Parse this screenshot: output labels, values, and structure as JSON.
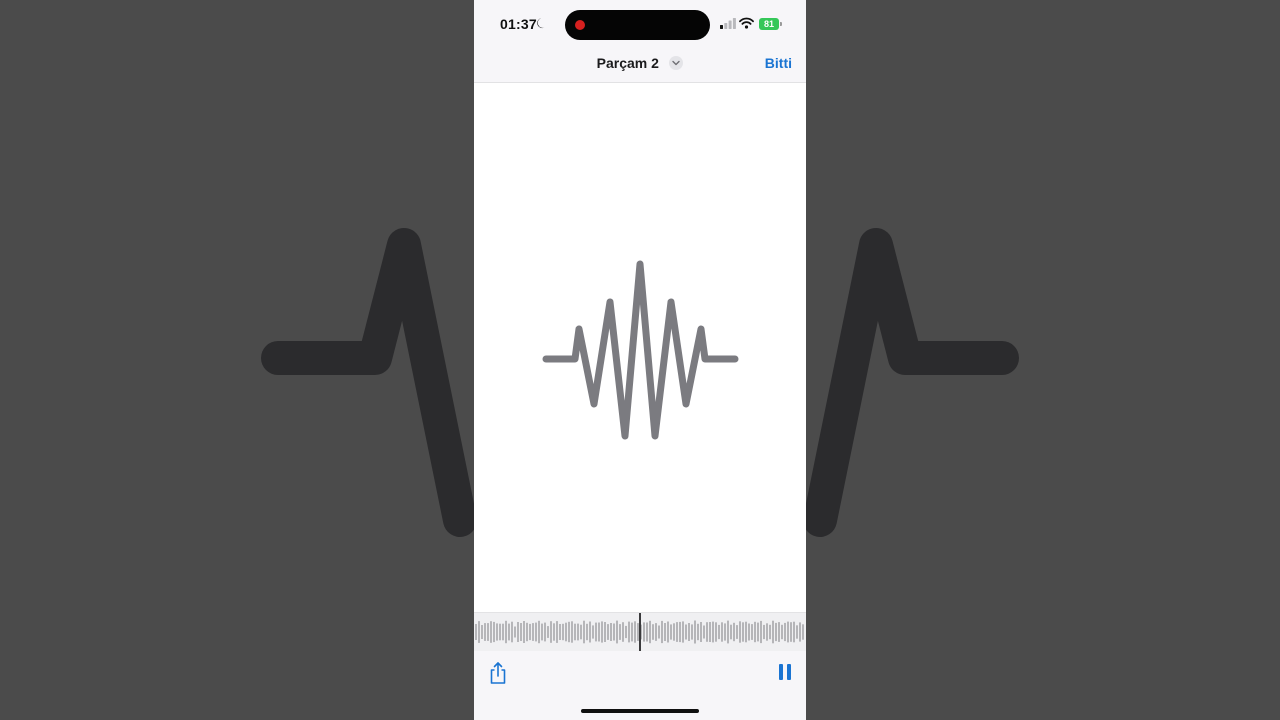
{
  "status_bar": {
    "time": "01:37",
    "battery_level": "81",
    "icons": [
      "moon-icon",
      "recording-dot-icon",
      "cellular-signal-icon",
      "wifi-icon",
      "battery-icon"
    ],
    "colors": {
      "recording": "#d6201f",
      "battery": "#35c759"
    }
  },
  "nav": {
    "title": "Parçam 2",
    "title_menu_icon": "chevron-down-icon",
    "done_label": "Bitti",
    "accent_color": "#1a74d2"
  },
  "main": {
    "artwork_icon": "waveform-icon",
    "artwork_color": "#7b7b80"
  },
  "playback": {
    "share_icon": "share-icon",
    "pause_icon": "pause-icon",
    "state": "playing"
  }
}
